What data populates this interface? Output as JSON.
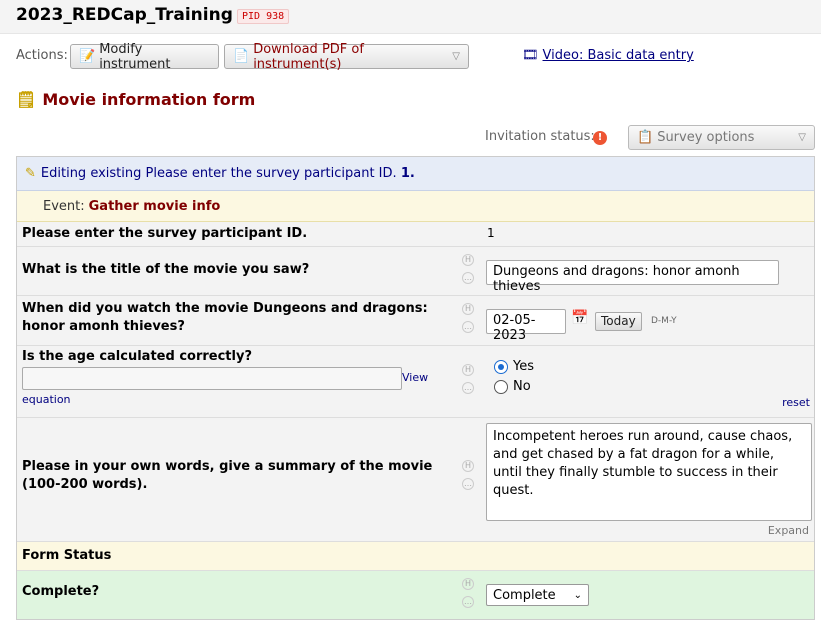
{
  "project": {
    "title": "2023_REDCap_Training",
    "pid": "PID 938"
  },
  "actions": {
    "label": "Actions:",
    "modify_label": "Modify instrument",
    "pdf_label": "Download PDF of instrument(s)",
    "video_label": "Video: Basic data entry"
  },
  "form": {
    "title": "Movie information form"
  },
  "invitation": {
    "label": "Invitation status:",
    "survey_options_label": "Survey options"
  },
  "editing": {
    "text": "Editing existing Please enter the survey participant ID.",
    "record": "1."
  },
  "event": {
    "label": "Event:",
    "name": "Gather movie info"
  },
  "fields": {
    "participant_id": {
      "label": "Please enter the survey participant ID.",
      "value": "1"
    },
    "movie_title": {
      "label": "What is the title of the movie you saw?",
      "value": "Dungeons and dragons: honor amonh thieves"
    },
    "watch_date": {
      "label": "When did you watch the movie Dungeons and dragons: honor amonh thieves?",
      "value": "02-05-2023",
      "today_label": "Today",
      "format": "D-M-Y"
    },
    "age_check": {
      "label": "Is the age calculated correctly?",
      "view_label": "View",
      "equation_label": "equation",
      "options": [
        "Yes",
        "No"
      ],
      "selected": "Yes",
      "reset_label": "reset"
    },
    "summary": {
      "label": "Please in your own words, give a summary of the movie (100-200 words).",
      "value": "Incompetent heroes run around, cause chaos, and get chased by a fat dragon for a while, until they finally stumble to success in their quest.",
      "expand_label": "Expand"
    }
  },
  "form_status": {
    "header": "Form Status",
    "complete_label": "Complete?",
    "complete_value": "Complete"
  },
  "colors": {
    "brand": "#800000",
    "link": "#000080",
    "status_row": "#dff5df",
    "event_row": "#fcf8e1",
    "edit_row": "#e6ecf7"
  }
}
